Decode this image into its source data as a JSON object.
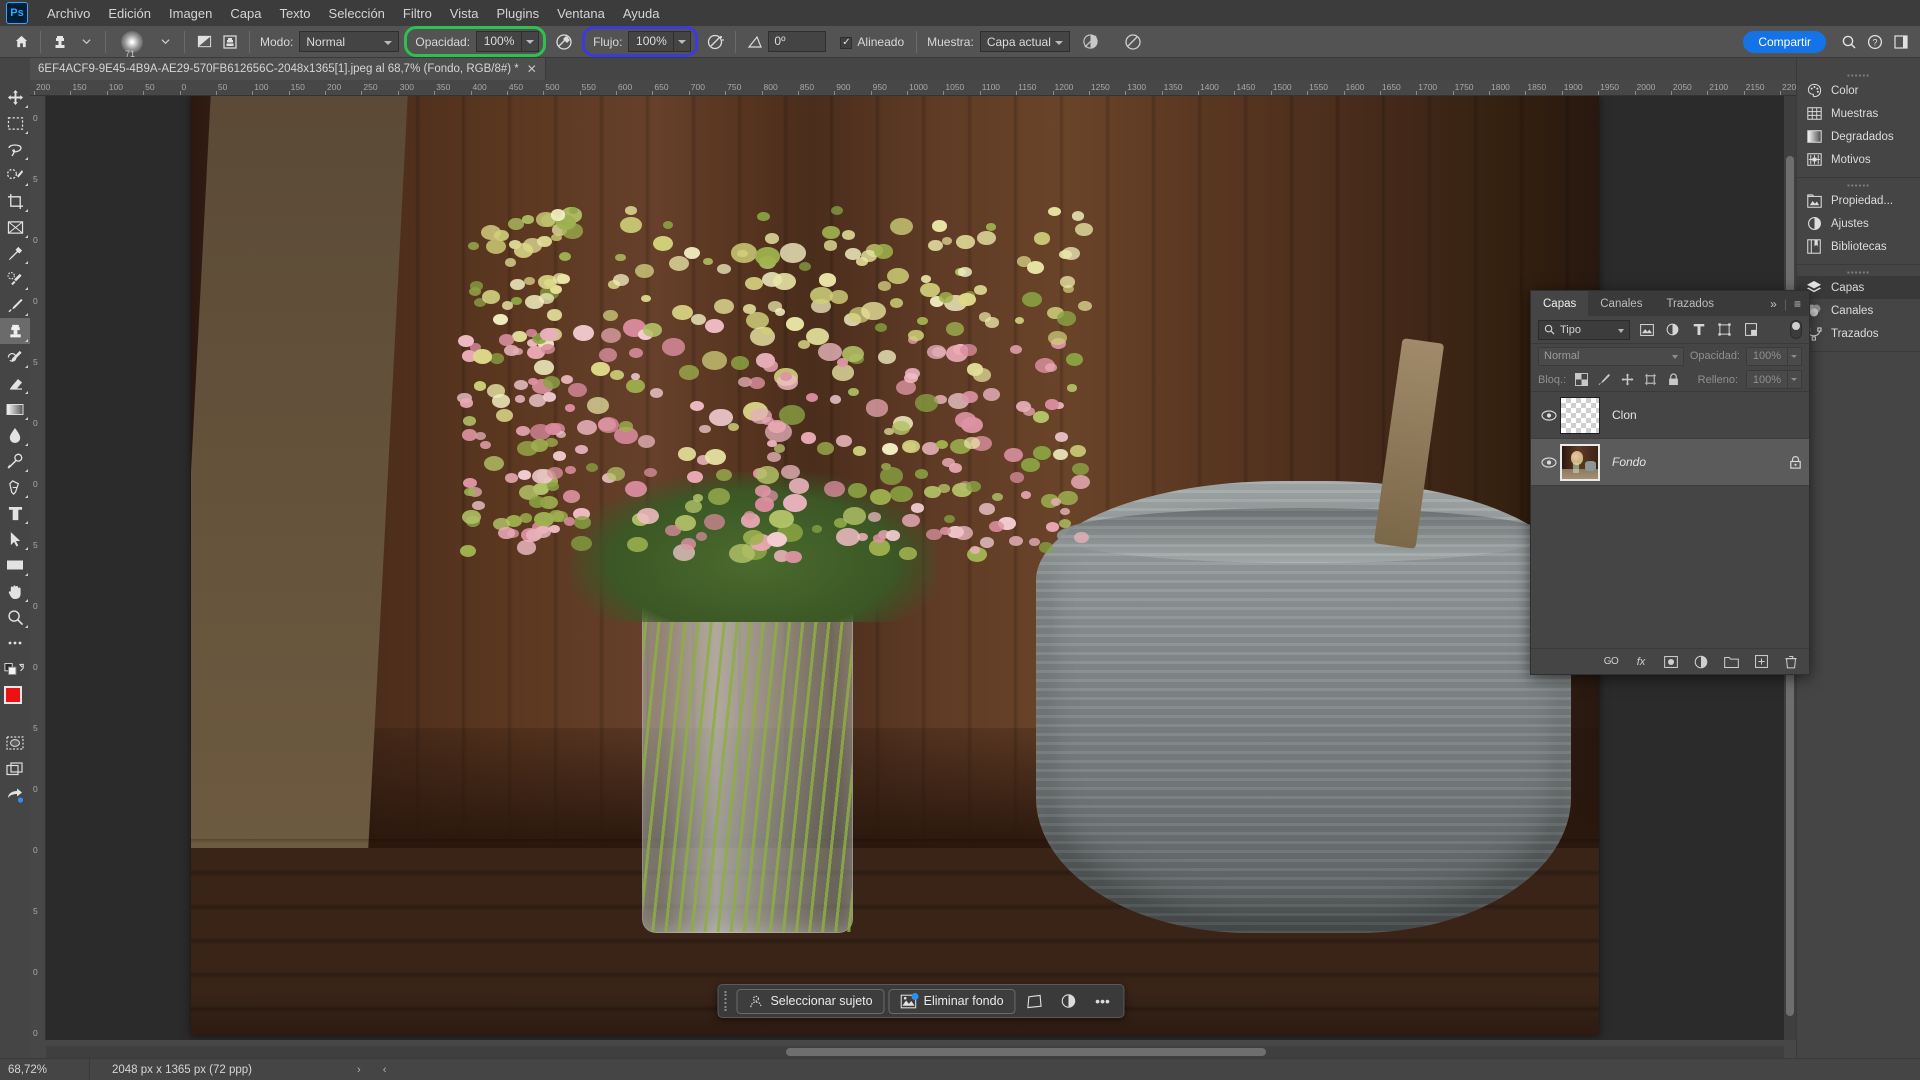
{
  "app": {
    "logo_text": "Ps",
    "share_label": "Compartir"
  },
  "menubar": {
    "items": [
      {
        "label": "Archivo"
      },
      {
        "label": "Edición"
      },
      {
        "label": "Imagen"
      },
      {
        "label": "Capa"
      },
      {
        "label": "Texto"
      },
      {
        "label": "Selección"
      },
      {
        "label": "Filtro"
      },
      {
        "label": "Vista"
      },
      {
        "label": "Plugins"
      },
      {
        "label": "Ventana"
      },
      {
        "label": "Ayuda"
      }
    ]
  },
  "options_bar": {
    "home_icon": "home-icon",
    "tool_preset_icon": "clone-stamp-icon",
    "brush_size": "71",
    "brush_preset_icon": "brush-preset-icon",
    "toggle_brush_panel_icon": "brush-panel-icon",
    "clone_source_icon": "clone-source-icon",
    "mode_label": "Modo:",
    "mode_value": "Normal",
    "opacity_label": "Opacidad:",
    "opacity_value": "100%",
    "opacity_highlight_color": "#2dc24f",
    "pressure_opacity_icon": "pressure-opacity-icon",
    "flow_label": "Flujo:",
    "flow_value": "100%",
    "flow_highlight_color": "#3b3bdd",
    "airbrush_icon": "airbrush-icon",
    "angle_icon": "angle-icon",
    "angle_value": "0º",
    "aligned_label": "Alineado",
    "aligned_checked": true,
    "sample_label": "Muestra:",
    "sample_value": "Capa actual",
    "ignore_adjustment_icon": "ignore-adjustment-icon",
    "pressure_size_icon": "pressure-size-icon"
  },
  "document_tab": {
    "title": "6EF4ACF9-9E45-4B9A-AE29-570FB612656C-2048x1365[1].jpeg al 68,7% (Fondo, RGB/8#) *",
    "close_glyph": "✕",
    "collapse_glyph": "»",
    "expand_glyph": "«"
  },
  "toolbar": {
    "tools": [
      {
        "name": "move-tool",
        "active": false
      },
      {
        "name": "rectangular-marquee-tool",
        "active": false
      },
      {
        "name": "lasso-tool",
        "active": false
      },
      {
        "name": "object-selection-tool",
        "active": false
      },
      {
        "name": "crop-tool",
        "active": false
      },
      {
        "name": "frame-tool",
        "active": false
      },
      {
        "name": "eyedropper-tool",
        "active": false
      },
      {
        "name": "spot-healing-brush-tool",
        "active": false
      },
      {
        "name": "brush-tool",
        "active": false
      },
      {
        "name": "clone-stamp-tool",
        "active": true
      },
      {
        "name": "history-brush-tool",
        "active": false
      },
      {
        "name": "eraser-tool",
        "active": false
      },
      {
        "name": "gradient-tool",
        "active": false
      },
      {
        "name": "blur-tool",
        "active": false
      },
      {
        "name": "dodge-tool",
        "active": false
      },
      {
        "name": "pen-tool",
        "active": false
      },
      {
        "name": "type-tool",
        "active": false
      },
      {
        "name": "path-selection-tool",
        "active": false
      },
      {
        "name": "rectangle-tool",
        "active": false
      },
      {
        "name": "hand-tool",
        "active": false
      },
      {
        "name": "zoom-tool",
        "active": false
      },
      {
        "name": "edit-toolbar-tool",
        "active": false
      }
    ],
    "foreground_color": "#ee1111",
    "background_color": "#ffffff",
    "quick_mask_icon": "quick-mask-icon",
    "screen_mode_icon": "screen-mode-icon",
    "share_tool_icon": "share-tool-icon"
  },
  "rulers": {
    "unit": "px",
    "horizontal_ticks": [
      "200",
      "150",
      "100",
      "50",
      "0",
      "50",
      "100",
      "150",
      "200",
      "250",
      "300",
      "350",
      "400",
      "450",
      "500",
      "550",
      "600",
      "650",
      "700",
      "750",
      "800",
      "850",
      "900",
      "950",
      "1000",
      "1050",
      "1100",
      "1150",
      "1200",
      "1250",
      "1300",
      "1350",
      "1400",
      "1450",
      "1500",
      "1550",
      "1600",
      "1650",
      "1700",
      "1750",
      "1800",
      "1850",
      "1900",
      "1950",
      "2000",
      "2050",
      "2100",
      "2150",
      "2200"
    ],
    "vertical_ticks": [
      "0",
      "5",
      "0",
      "0",
      "5",
      "0",
      "0",
      "5",
      "0",
      "0",
      "5",
      "0",
      "0",
      "5",
      "0",
      "0"
    ]
  },
  "context_toolbar": {
    "select_subject_label": "Seleccionar sujeto",
    "remove_background_label": "Eliminar fondo",
    "transform_icon": "transform-icon",
    "adjustment-icon": "adjustment-icon",
    "more_glyph": "•••"
  },
  "dock": {
    "groups": [
      {
        "items": [
          {
            "label": "Color",
            "icon": "color-palette-icon",
            "active": false
          },
          {
            "label": "Muestras",
            "icon": "swatches-grid-icon",
            "active": false
          },
          {
            "label": "Degradados",
            "icon": "gradients-icon",
            "active": false
          },
          {
            "label": "Motivos",
            "icon": "patterns-icon",
            "active": false
          }
        ]
      },
      {
        "items": [
          {
            "label": "Propiedad...",
            "icon": "properties-icon",
            "active": false
          },
          {
            "label": "Ajustes",
            "icon": "adjustments-icon",
            "active": false
          },
          {
            "label": "Bibliotecas",
            "icon": "libraries-icon",
            "active": false
          }
        ]
      },
      {
        "items": [
          {
            "label": "Capas",
            "icon": "layers-icon",
            "active": true
          },
          {
            "label": "Canales",
            "icon": "channels-icon",
            "active": false
          },
          {
            "label": "Trazados",
            "icon": "paths-icon",
            "active": false
          }
        ]
      }
    ]
  },
  "layers_panel": {
    "tabs": [
      {
        "label": "Capas",
        "active": true
      },
      {
        "label": "Canales",
        "active": false
      },
      {
        "label": "Trazados",
        "active": false
      }
    ],
    "collapse_glyph": "»",
    "menu_glyph": "≡",
    "filter": {
      "search_icon": "search-icon",
      "kind_label": "Tipo",
      "icons": [
        {
          "name": "filter-pixel-icon"
        },
        {
          "name": "filter-adjustment-icon"
        },
        {
          "name": "filter-type-icon"
        },
        {
          "name": "filter-shape-icon"
        },
        {
          "name": "filter-smart-object-icon"
        }
      ],
      "toggle_on": false
    },
    "blend_mode": "Normal",
    "opacity_label": "Opacidad:",
    "opacity_value": "100%",
    "lock_label": "Bloq.:",
    "lock_icons": [
      {
        "name": "lock-transparent-pixels-icon"
      },
      {
        "name": "lock-image-pixels-icon"
      },
      {
        "name": "lock-position-icon"
      },
      {
        "name": "lock-artboard-nesting-icon"
      },
      {
        "name": "lock-all-icon"
      }
    ],
    "fill_label": "Relleno:",
    "fill_value": "100%",
    "layers": [
      {
        "name": "Clon",
        "visible": true,
        "thumb": "transparent",
        "selected": false,
        "locked": false,
        "italic": false
      },
      {
        "name": "Fondo",
        "visible": true,
        "thumb": "photo",
        "selected": true,
        "locked": true,
        "italic": true
      }
    ],
    "footer_icons": [
      {
        "name": "link-layers-icon",
        "glyph": "GO"
      },
      {
        "name": "layer-style-icon",
        "glyph": "fx"
      },
      {
        "name": "layer-mask-icon",
        "glyph": ""
      },
      {
        "name": "new-fill-adjustment-layer-icon",
        "glyph": ""
      },
      {
        "name": "new-group-icon",
        "glyph": ""
      },
      {
        "name": "new-layer-icon",
        "glyph": ""
      },
      {
        "name": "delete-layer-icon",
        "glyph": ""
      }
    ]
  },
  "status_bar": {
    "zoom": "68,72%",
    "doc_info": "2048 px x 1365 px (72 ppp)",
    "next_glyph": "›",
    "prev_glyph": "‹"
  }
}
